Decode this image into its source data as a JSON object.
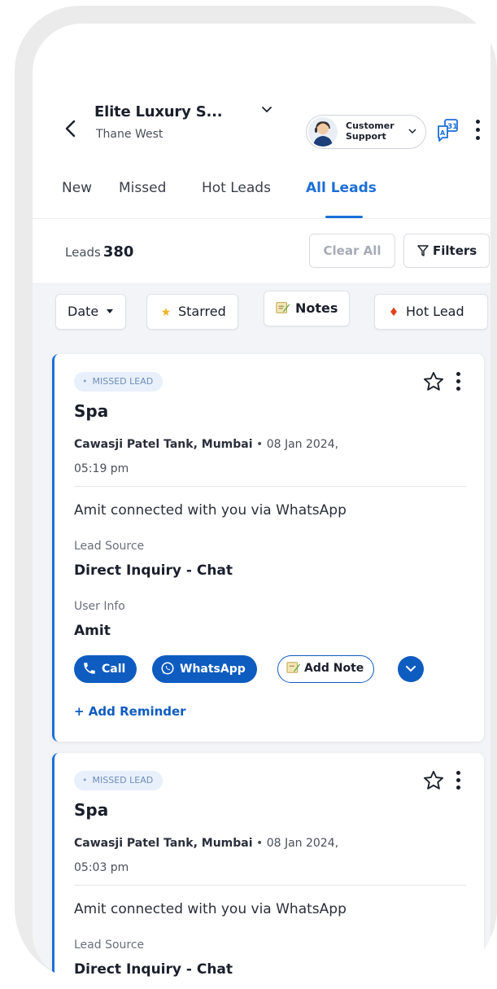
{
  "header": {
    "store_name": "Elite Luxury S...",
    "store_area": "Thane West",
    "support": {
      "label_line1": "Customer",
      "label_line2": "Support"
    }
  },
  "tabs": [
    {
      "label": "New",
      "active": false
    },
    {
      "label": "Missed",
      "active": false
    },
    {
      "label": "Hot Leads",
      "active": false
    },
    {
      "label": "All Leads",
      "active": true
    }
  ],
  "leads_summary": {
    "label": "Leads",
    "count": "380",
    "clear_label": "Clear All",
    "filters_label": "Filters"
  },
  "chips": [
    {
      "label": "Date",
      "icon": "caret-down-icon"
    },
    {
      "label": "Starred",
      "icon": "star-icon"
    },
    {
      "label": "Notes",
      "icon": "notes-icon"
    },
    {
      "label": "Hot Lead",
      "icon": "fire-icon"
    }
  ],
  "leads": [
    {
      "badge": "MISSED LEAD",
      "title": "Spa",
      "location": "Cawasji Patel Tank, Mumbai",
      "separator": " • ",
      "datetime_line1": "08 Jan 2024,",
      "datetime_line2": "05:19 pm",
      "message": "Amit connected with you via WhatsApp",
      "lead_source_label": "Lead Source",
      "lead_source_value": "Direct Inquiry - Chat",
      "user_info_label": "User Info",
      "user_info_value": "Amit",
      "call_label": "Call",
      "whatsapp_label": "WhatsApp",
      "note_label": "Add Note",
      "reminder_label": "+ Add Reminder"
    },
    {
      "badge": "MISSED LEAD",
      "title": "Spa",
      "location": "Cawasji Patel Tank, Mumbai",
      "separator": " • ",
      "datetime_line1": "08 Jan 2024,",
      "datetime_line2": "05:03 pm",
      "message": "Amit connected with you via WhatsApp",
      "lead_source_label": "Lead Source",
      "lead_source_value": "Direct Inquiry - Chat"
    }
  ],
  "colors": {
    "accent": "#1c6fd6",
    "button_blue": "#0f5cc0",
    "badge_bg": "#e8f0fc"
  }
}
